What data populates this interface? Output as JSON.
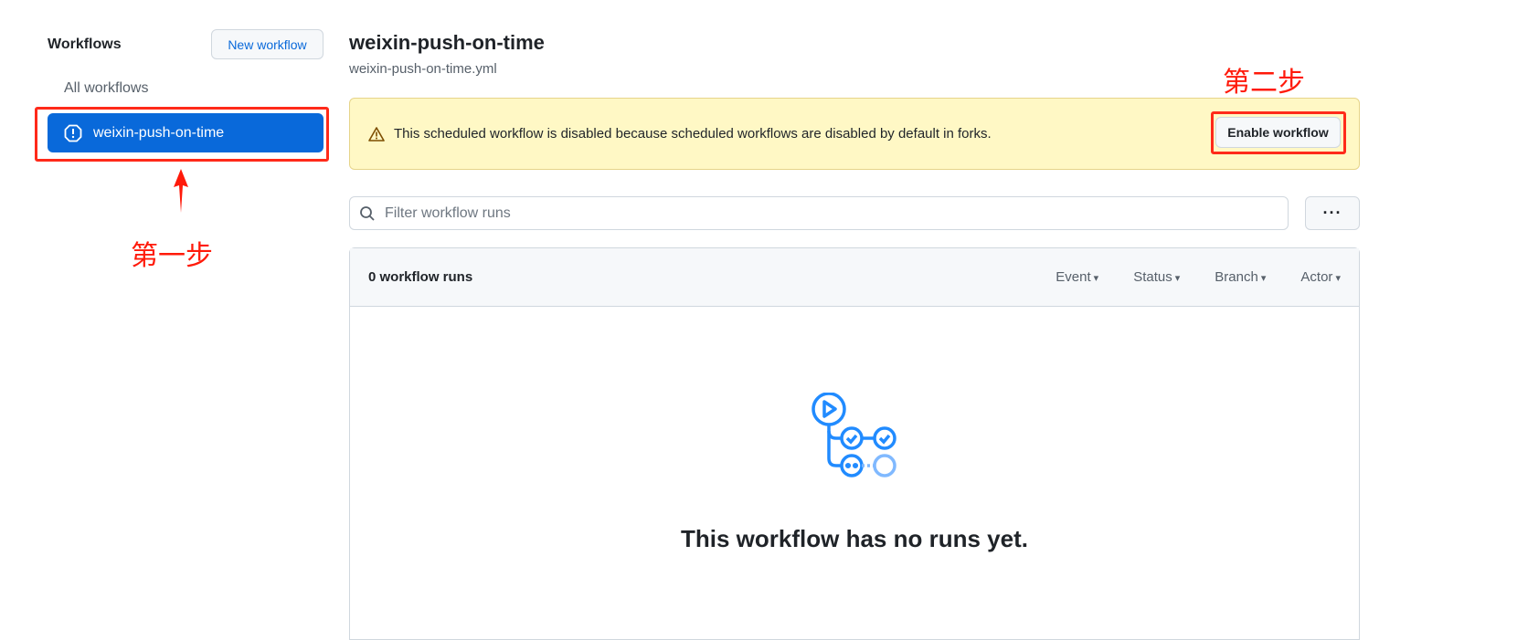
{
  "sidebar": {
    "title": "Workflows",
    "new_button": "New workflow",
    "all_workflows": "All workflows",
    "items": [
      {
        "label": "weixin-push-on-time",
        "icon": "alert-octagon-icon",
        "selected": true
      }
    ]
  },
  "annotations": {
    "step1": "第一步",
    "step2": "第二步",
    "color": "#ff1a0a"
  },
  "main": {
    "title": "weixin-push-on-time",
    "file": "weixin-push-on-time.yml",
    "banner": {
      "text": "This scheduled workflow is disabled because scheduled workflows are disabled by default in forks.",
      "button": "Enable workflow",
      "icon": "warning-icon"
    },
    "filter": {
      "placeholder": "Filter workflow runs"
    },
    "more_label": "···",
    "runs": {
      "count_label": "0 workflow runs",
      "filters": [
        "Event",
        "Status",
        "Branch",
        "Actor"
      ],
      "empty_text": "This workflow has no runs yet."
    }
  }
}
